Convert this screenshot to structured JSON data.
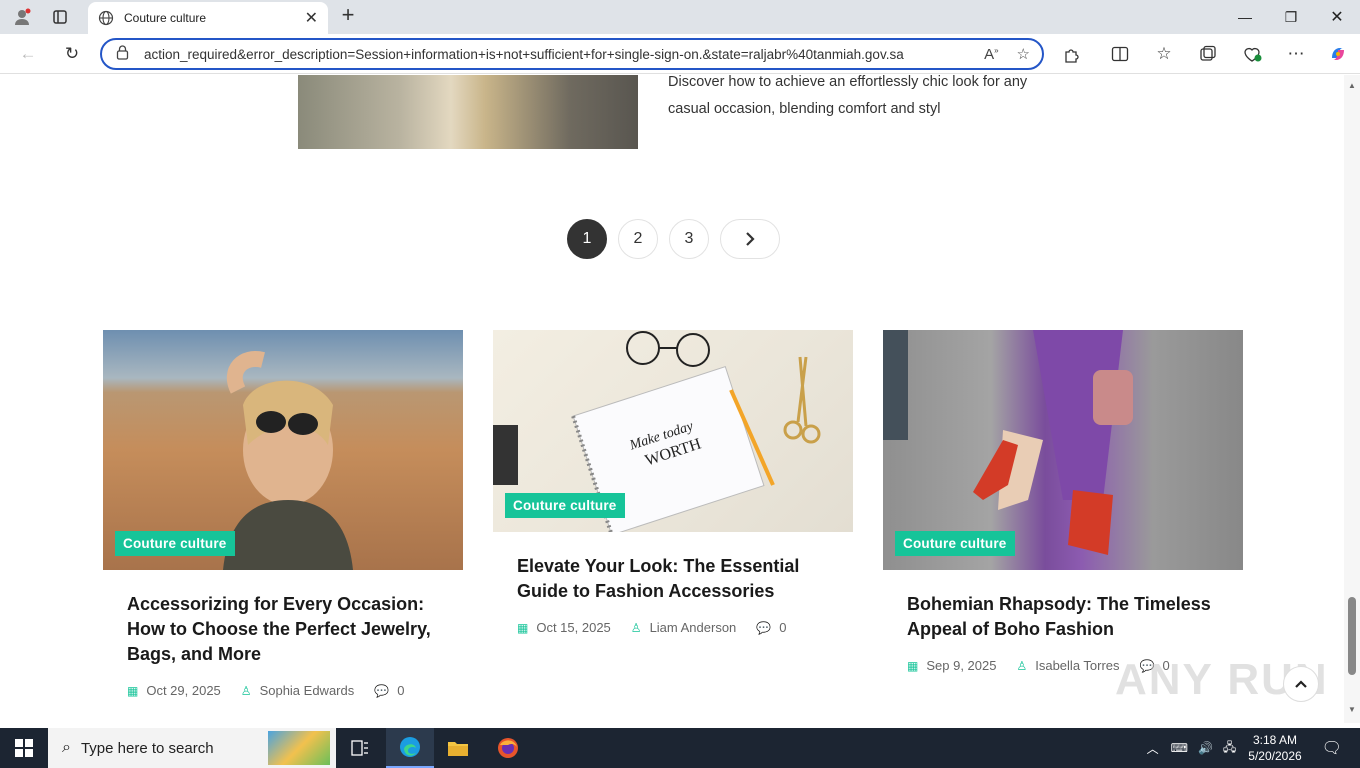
{
  "browser": {
    "tab_title": "Couture culture",
    "url": "action_required&error_description=Session+information+is+not+sufficient+for+single-sign-on.&state=raljabr%40tanmiah.gov.sa"
  },
  "previous_post": {
    "excerpt": "Discover how to achieve an effortlessly chic look for any casual occasion, blending comfort and styl"
  },
  "pagination": {
    "pages": [
      "1",
      "2",
      "3"
    ],
    "active": "1",
    "next_icon": "chevron-right-icon"
  },
  "cards": [
    {
      "category": "Couture culture",
      "title": "Accessorizing for Every Occasion: How to Choose the Perfect Jewelry, Bags, and More",
      "date": "Oct 29, 2025",
      "author": "Sophia Edwards",
      "comments": "0"
    },
    {
      "category": "Couture culture",
      "title": "Elevate Your Look: The Essential Guide to Fashion Accessories",
      "date": "Oct 15, 2025",
      "author": "Liam Anderson",
      "comments": "0"
    },
    {
      "category": "Couture culture",
      "title": "Bohemian Rhapsody: The Timeless Appeal of Boho Fashion",
      "date": "Sep 9, 2025",
      "author": "Isabella Torres",
      "comments": "0"
    }
  ],
  "taskbar": {
    "search_placeholder": "Type here to search",
    "time": "3:18 AM",
    "date": "5/20/2026"
  },
  "watermark": "ANY RUN",
  "colors": {
    "accent": "#16c499",
    "url_border": "#2456c7",
    "active_page": "#333333"
  }
}
